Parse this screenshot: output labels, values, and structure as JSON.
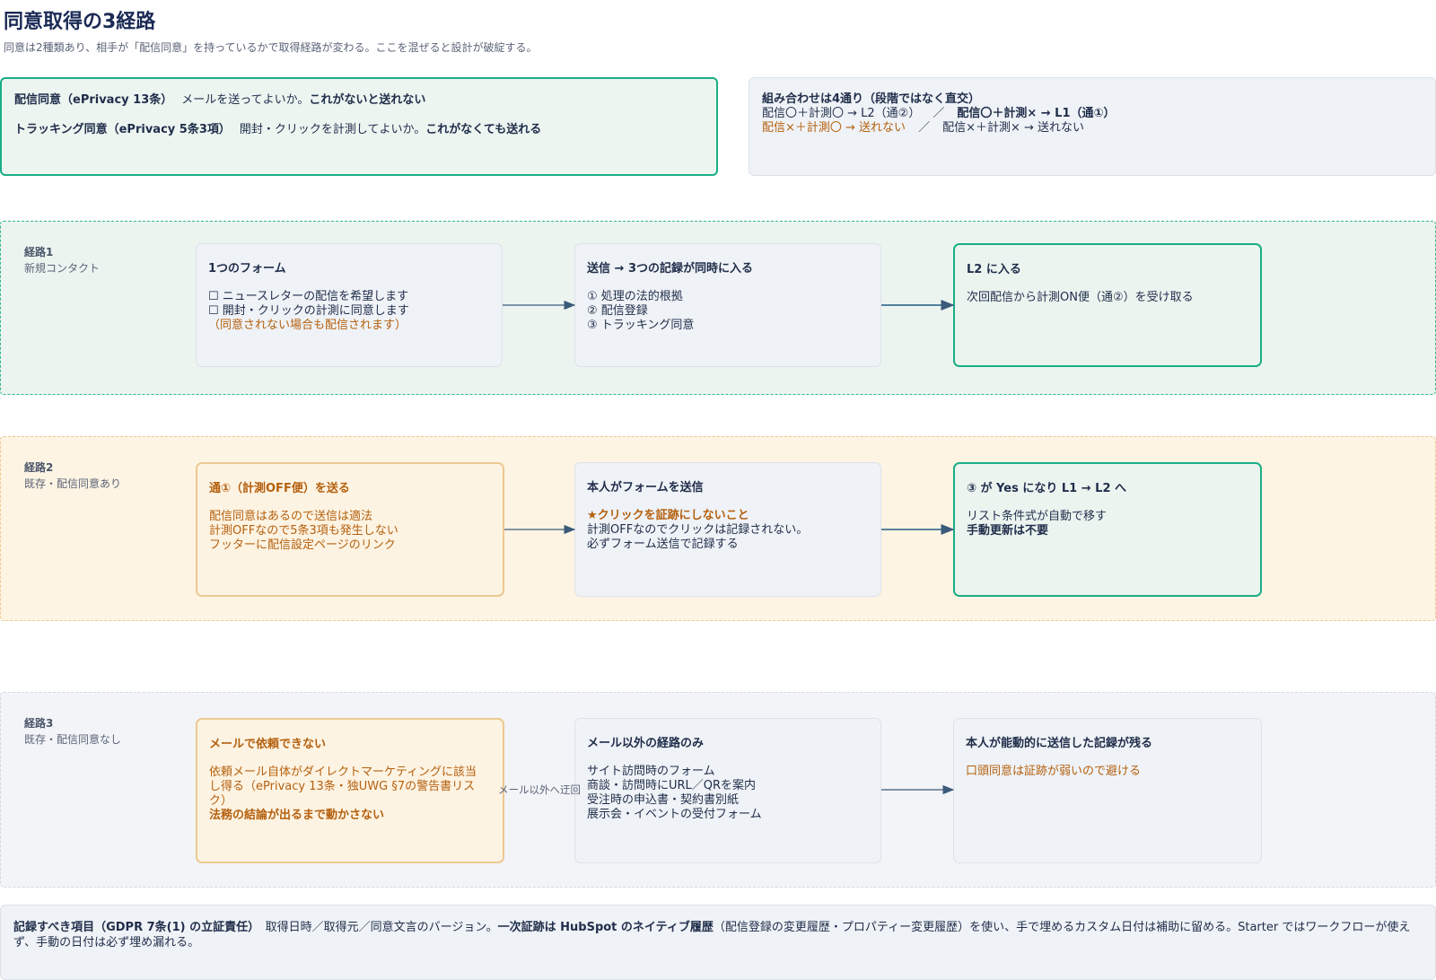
{
  "title": "同意取得の3経路",
  "subtitle": "同意は2種類あり、相手が「配信同意」を持っているかで取得経路が変わる。ここを混ぜると設計が破綻する。",
  "consent_types": [
    {
      "label": "配信同意（ePrivacy 13条）",
      "desc": "メールを送ってよいか。",
      "emphasis": "これがないと送れない"
    },
    {
      "label": "トラッキング同意（ePrivacy 5条3項）",
      "desc": "開封・クリックを計測してよいか。",
      "emphasis": "これがなくても送れる"
    }
  ],
  "combinations": {
    "title": "組み合わせは4通り（段階ではなく直交）",
    "c1": "配信〇＋計測〇 → L2（通②）",
    "c2": "配信〇＋計測× → L1（通①）",
    "c3": "配信×＋計測〇 → 送れない",
    "c4": "配信×＋計測× → 送れない",
    "separator": "／"
  },
  "lanes": [
    {
      "name": "経路1",
      "sub": "新規コンタクト",
      "nodes": [
        {
          "title": "1つのフォーム",
          "lines": [
            "☐ ニュースレターの配信を希望します",
            "☐ 開封・クリックの計測に同意します"
          ],
          "note": "（同意されない場合も配信されます）"
        },
        {
          "title": "送信 → 3つの記録が同時に入る",
          "lines": [
            "① 処理の法的根拠",
            "② 配信登録",
            "③ トラッキング同意"
          ]
        },
        {
          "title": "L2 に入る",
          "lines": [
            "次回配信から計測ON便（通②）を受け取る"
          ]
        }
      ]
    },
    {
      "name": "経路2",
      "sub": "既存・配信同意あり",
      "nodes": [
        {
          "title": "通①（計測OFF便）を送る",
          "lines": [
            "配信同意はあるので送信は適法",
            "計測OFFなので5条3項も発生しない",
            "フッターに配信設定ページのリンク"
          ]
        },
        {
          "title": "本人がフォームを送信",
          "emphasis": "★クリックを証跡にしないこと",
          "lines": [
            "計測OFFなのでクリックは記録されない。",
            "必ずフォーム送信で記録する"
          ]
        },
        {
          "title": "③ が Yes になり L1 → L2 へ",
          "lines": [
            "リスト条件式が自動で移す"
          ],
          "emphasis": "手動更新は不要"
        }
      ]
    },
    {
      "name": "経路3",
      "sub": "既存・配信同意なし",
      "nodes": [
        {
          "title": "メールで依頼できない",
          "lines": [
            "依頼メール自体がダイレクトマーケティングに該当",
            "し得る（ePrivacy 13条・独UWG §7の警告書リス",
            "ク）"
          ],
          "emphasis": "法務の結論が出るまで動かさない"
        },
        {
          "title": "メール以外の経路のみ",
          "lines": [
            "サイト訪問時のフォーム",
            "商談・訪問時にURL／QRを案内",
            "受注時の申込書・契約書別紙",
            "展示会・イベントの受付フォーム"
          ]
        },
        {
          "title": "本人が能動的に送信した記録が残る",
          "note": "口頭同意は証跡が弱いので避ける"
        }
      ],
      "edge_label": "メール以外へ迂回"
    }
  ],
  "footer": {
    "label": "記録すべき項目（GDPR 7条(1) の立証責任）",
    "text1": "取得日時／取得元／同意文言のバージョン。",
    "emphasis": "一次証跡は HubSpot のネイティブ履歴",
    "text2": "（配信登録の変更履歴・プロパティー変更履歴）を使い、手で埋めるカスタム日付は補助に留める。Starter ではワークフローが使えず、手動の日付は必ず埋め漏れる。"
  },
  "colors": {
    "green": "#1aae85",
    "orange": "#b5600e",
    "navy": "#1b2a55",
    "arrow": "#3b5a7a"
  }
}
